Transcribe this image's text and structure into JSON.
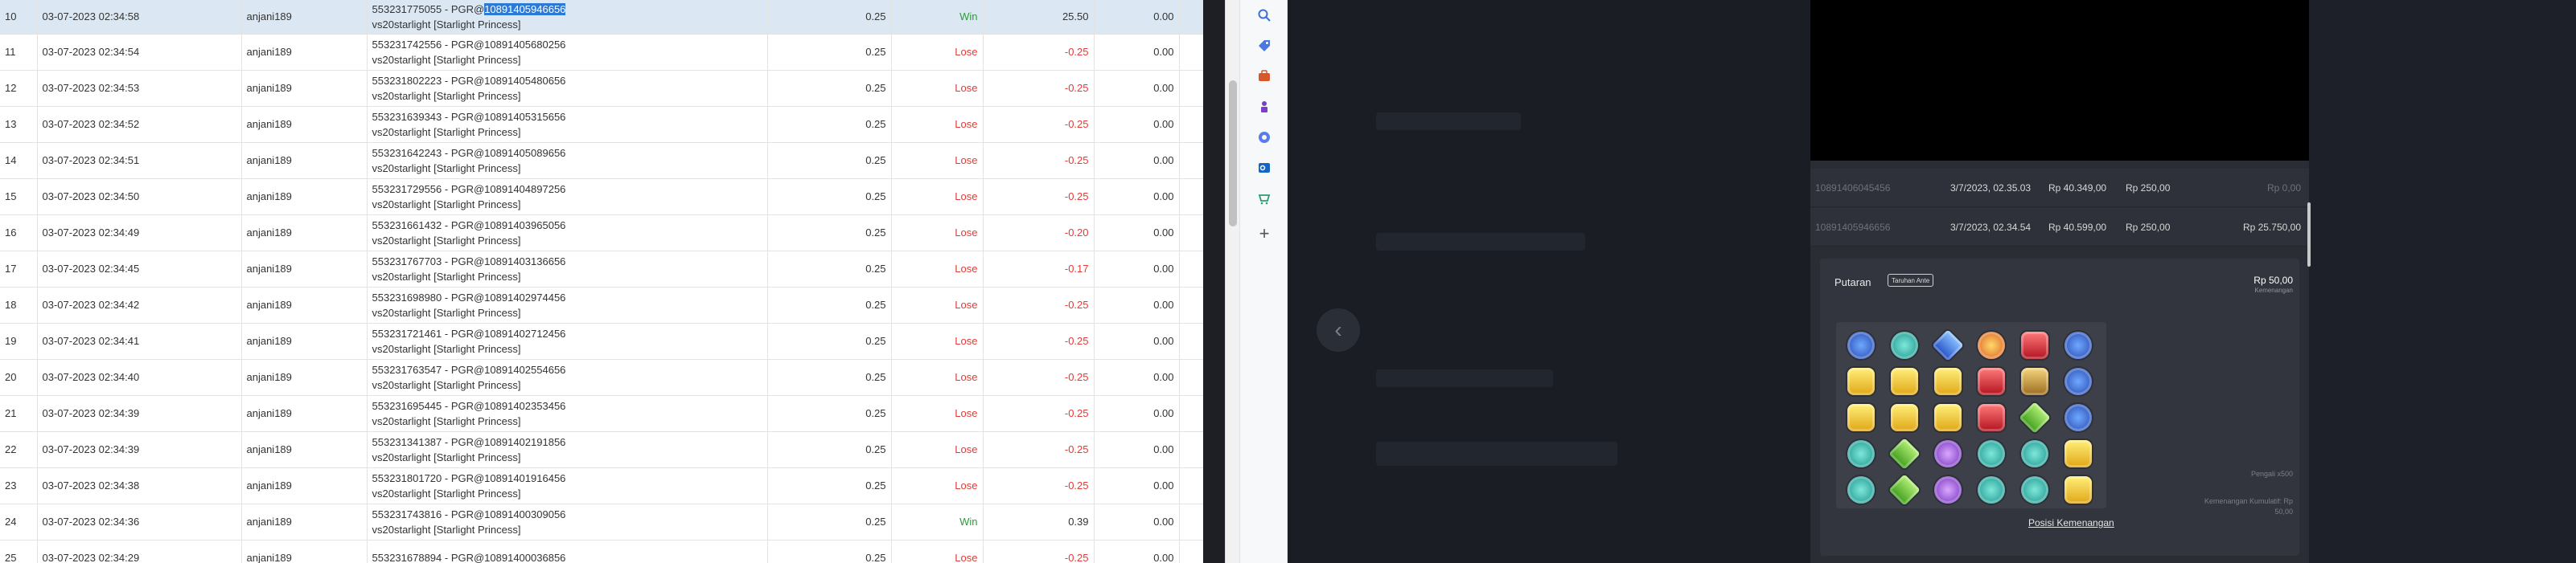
{
  "table": {
    "rows": [
      {
        "no": "10",
        "date": "03-07-2023 02:34:58",
        "user": "anjani189",
        "desc1_pre": "553231775055 - PGR@",
        "desc1_hl": "10891405946656",
        "desc2": "vs20starlight [Starlight Princess]",
        "bet": "0.25",
        "result": "Win",
        "amount": "25.50",
        "balance": "0.00"
      },
      {
        "no": "11",
        "date": "03-07-2023 02:34:54",
        "user": "anjani189",
        "desc1_pre": "553231742556 - PGR@10891405680256",
        "desc1_hl": "",
        "desc2": "vs20starlight [Starlight Princess]",
        "bet": "0.25",
        "result": "Lose",
        "amount": "-0.25",
        "balance": "0.00"
      },
      {
        "no": "12",
        "date": "03-07-2023 02:34:53",
        "user": "anjani189",
        "desc1_pre": "553231802223 - PGR@10891405480656",
        "desc1_hl": "",
        "desc2": "vs20starlight [Starlight Princess]",
        "bet": "0.25",
        "result": "Lose",
        "amount": "-0.25",
        "balance": "0.00"
      },
      {
        "no": "13",
        "date": "03-07-2023 02:34:52",
        "user": "anjani189",
        "desc1_pre": "553231639343 - PGR@10891405315656",
        "desc1_hl": "",
        "desc2": "vs20starlight [Starlight Princess]",
        "bet": "0.25",
        "result": "Lose",
        "amount": "-0.25",
        "balance": "0.00"
      },
      {
        "no": "14",
        "date": "03-07-2023 02:34:51",
        "user": "anjani189",
        "desc1_pre": "553231642243 - PGR@10891405089656",
        "desc1_hl": "",
        "desc2": "vs20starlight [Starlight Princess]",
        "bet": "0.25",
        "result": "Lose",
        "amount": "-0.25",
        "balance": "0.00"
      },
      {
        "no": "15",
        "date": "03-07-2023 02:34:50",
        "user": "anjani189",
        "desc1_pre": "553231729556 - PGR@10891404897256",
        "desc1_hl": "",
        "desc2": "vs20starlight [Starlight Princess]",
        "bet": "0.25",
        "result": "Lose",
        "amount": "-0.25",
        "balance": "0.00"
      },
      {
        "no": "16",
        "date": "03-07-2023 02:34:49",
        "user": "anjani189",
        "desc1_pre": "553231661432 - PGR@10891403965056",
        "desc1_hl": "",
        "desc2": "vs20starlight [Starlight Princess]",
        "bet": "0.25",
        "result": "Lose",
        "amount": "-0.20",
        "balance": "0.00"
      },
      {
        "no": "17",
        "date": "03-07-2023 02:34:45",
        "user": "anjani189",
        "desc1_pre": "553231767703 - PGR@10891403136656",
        "desc1_hl": "",
        "desc2": "vs20starlight [Starlight Princess]",
        "bet": "0.25",
        "result": "Lose",
        "amount": "-0.17",
        "balance": "0.00"
      },
      {
        "no": "18",
        "date": "03-07-2023 02:34:42",
        "user": "anjani189",
        "desc1_pre": "553231698980 - PGR@10891402974456",
        "desc1_hl": "",
        "desc2": "vs20starlight [Starlight Princess]",
        "bet": "0.25",
        "result": "Lose",
        "amount": "-0.25",
        "balance": "0.00"
      },
      {
        "no": "19",
        "date": "03-07-2023 02:34:41",
        "user": "anjani189",
        "desc1_pre": "553231721461 - PGR@10891402712456",
        "desc1_hl": "",
        "desc2": "vs20starlight [Starlight Princess]",
        "bet": "0.25",
        "result": "Lose",
        "amount": "-0.25",
        "balance": "0.00"
      },
      {
        "no": "20",
        "date": "03-07-2023 02:34:40",
        "user": "anjani189",
        "desc1_pre": "553231763547 - PGR@10891402554656",
        "desc1_hl": "",
        "desc2": "vs20starlight [Starlight Princess]",
        "bet": "0.25",
        "result": "Lose",
        "amount": "-0.25",
        "balance": "0.00"
      },
      {
        "no": "21",
        "date": "03-07-2023 02:34:39",
        "user": "anjani189",
        "desc1_pre": "553231695445 - PGR@10891402353456",
        "desc1_hl": "",
        "desc2": "vs20starlight [Starlight Princess]",
        "bet": "0.25",
        "result": "Lose",
        "amount": "-0.25",
        "balance": "0.00"
      },
      {
        "no": "22",
        "date": "03-07-2023 02:34:39",
        "user": "anjani189",
        "desc1_pre": "553231341387 - PGR@10891402191856",
        "desc1_hl": "",
        "desc2": "vs20starlight [Starlight Princess]",
        "bet": "0.25",
        "result": "Lose",
        "amount": "-0.25",
        "balance": "0.00"
      },
      {
        "no": "23",
        "date": "03-07-2023 02:34:38",
        "user": "anjani189",
        "desc1_pre": "553231801720 - PGR@10891401916456",
        "desc1_hl": "",
        "desc2": "vs20starlight [Starlight Princess]",
        "bet": "0.25",
        "result": "Lose",
        "amount": "-0.25",
        "balance": "0.00"
      },
      {
        "no": "24",
        "date": "03-07-2023 02:34:36",
        "user": "anjani189",
        "desc1_pre": "553231743816 - PGR@10891400309056",
        "desc1_hl": "",
        "desc2": "vs20starlight [Starlight Princess]",
        "bet": "0.25",
        "result": "Win",
        "amount": "0.39",
        "balance": "0.00"
      },
      {
        "no": "25",
        "date": "03-07-2023 02:34:29",
        "user": "anjani189",
        "desc1_pre": "553231678894 - PGR@10891400036856",
        "desc1_hl": "",
        "desc2": "",
        "bet": "0.25",
        "result": "Lose",
        "amount": "-0.25",
        "balance": "0.00"
      }
    ]
  },
  "browser_sidebar": {
    "icons": [
      "search-icon",
      "tag-icon",
      "briefcase-icon",
      "chess-icon",
      "copilot-icon",
      "outlook-icon",
      "shopping-icon",
      "add-icon"
    ]
  },
  "game": {
    "history": [
      {
        "id": "10891406045456",
        "datetime": "3/7/2023, 02.35.03",
        "total": "Rp 40.349,00",
        "bet": "Rp 250,00",
        "win": "Rp 0,00"
      },
      {
        "id": "10891405946656",
        "datetime": "3/7/2023, 02.34.54",
        "total": "Rp 40.599,00",
        "bet": "Rp 250,00",
        "win": "Rp 25.750,00"
      }
    ],
    "round": {
      "label": "Putaran",
      "tag": "Taruhan Ante",
      "win_amount": "Rp 50,00",
      "win_caption": "Kemenangan",
      "multiplier_info": "Pengali x500",
      "cumulative_label": "Kemenangan Kumulatif: Rp",
      "cumulative_value": "50,00",
      "positions_link": "Posisi Kemenangan"
    },
    "symbols": [
      [
        "blue-star",
        "teal-gem",
        "blue-drop",
        "red-sun",
        "red-heart",
        "blue-star"
      ],
      [
        "yellow-gem",
        "yellow-gem",
        "yellow-gem",
        "red-heart",
        "wings-crown",
        "blue-star"
      ],
      [
        "yellow-gem",
        "yellow-gem",
        "yellow-gem",
        "red-heart",
        "green-gem",
        "blue-star"
      ],
      [
        "teal-gem",
        "green-gem",
        "purple-moon",
        "teal-gem",
        "teal-gem",
        "yellow-gem"
      ],
      [
        "teal-gem",
        "green-gem",
        "purple-moon",
        "teal-gem",
        "teal-gem",
        "yellow-gem"
      ]
    ],
    "colors": {
      "win": "#2e9a3a",
      "lose": "#e53935",
      "highlight": "#2d7ad6",
      "selected_row": "#dbe8f4"
    }
  }
}
